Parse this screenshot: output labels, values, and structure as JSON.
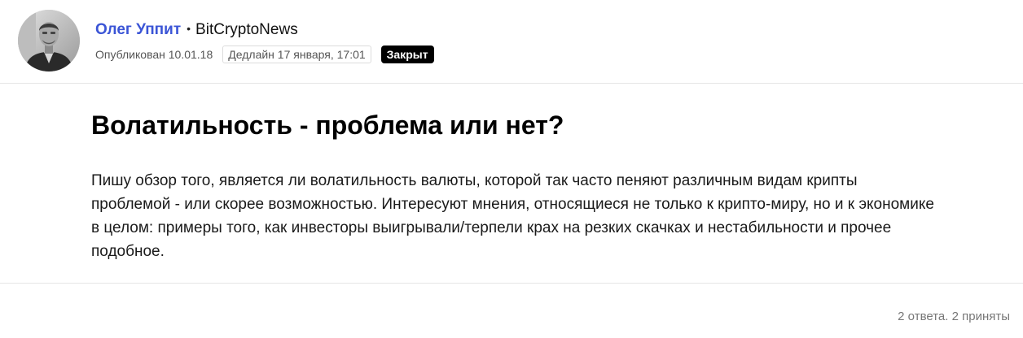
{
  "author": {
    "name": "Олег Уппит",
    "separator": "•",
    "source": "BitCryptoNews",
    "avatar_icon": "person-photo-avatar"
  },
  "meta": {
    "published": "Опубликован 10.01.18",
    "deadline": "Дедлайн 17 января, 17:01",
    "status": "Закрыт"
  },
  "question": {
    "title": "Волатильность - проблема или нет?",
    "body": "Пишу обзор того, является ли волатильность валюты, которой так часто пеняют различным видам крипты проблемой - или скорее возможностью. Интересуют мнения, относящиеся не только к крипто-миру, но и к экономике в целом: примеры того, как инвесторы выигрывали/терпели крах на резких скачках и нестабильности и прочее подобное."
  },
  "footer": {
    "answers": "2 ответа. 2 приняты"
  },
  "colors": {
    "author_link": "#3b55d6",
    "badge_bg": "#000000",
    "divider": "#e6e6e6"
  }
}
